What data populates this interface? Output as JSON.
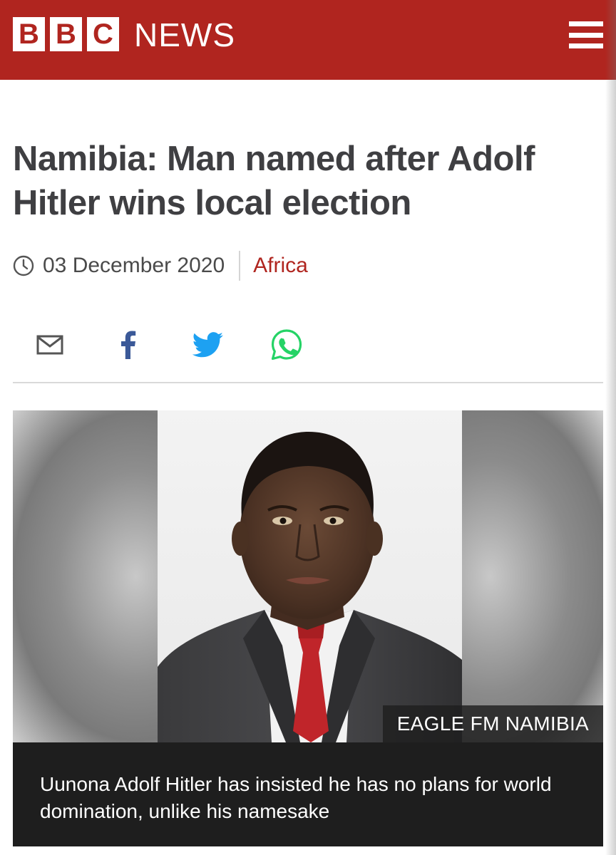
{
  "header": {
    "logo_letters": [
      "B",
      "B",
      "C"
    ],
    "news_word": "NEWS",
    "brand_color": "#b0251f",
    "menu_icon": "hamburger-menu-icon"
  },
  "article": {
    "headline": "Namibia: Man named after Adolf Hitler wins local election",
    "date": "03 December 2020",
    "category": "Africa",
    "share_icons": [
      "email-icon",
      "facebook-icon",
      "twitter-icon",
      "whatsapp-icon"
    ],
    "image": {
      "credit": "EAGLE FM NAMIBIA",
      "caption": "Uunona Adolf Hitler has insisted he has no plans for world domination, unlike his namesake"
    }
  }
}
